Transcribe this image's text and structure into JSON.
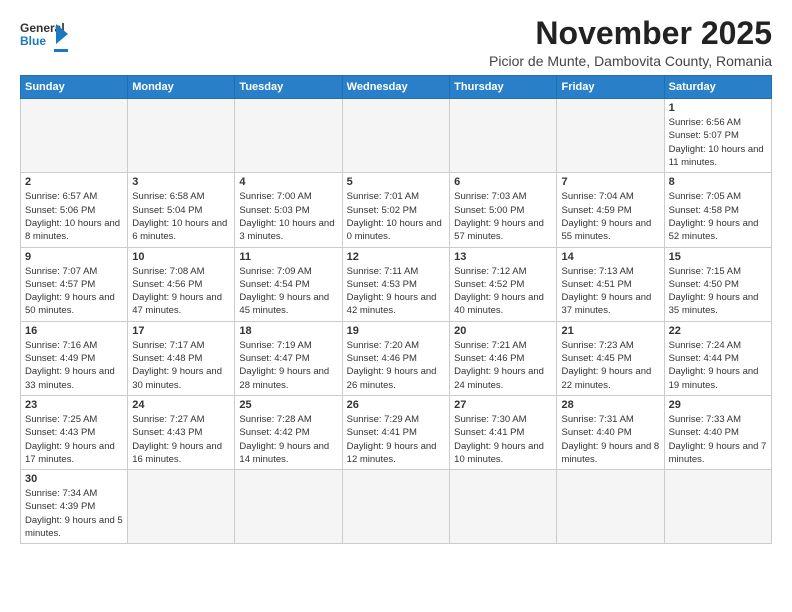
{
  "header": {
    "logo_general": "General",
    "logo_blue": "Blue",
    "month_title": "November 2025",
    "subtitle": "Picior de Munte, Dambovita County, Romania"
  },
  "weekdays": [
    "Sunday",
    "Monday",
    "Tuesday",
    "Wednesday",
    "Thursday",
    "Friday",
    "Saturday"
  ],
  "weeks": [
    [
      {
        "day": "",
        "empty": true
      },
      {
        "day": "",
        "empty": true
      },
      {
        "day": "",
        "empty": true
      },
      {
        "day": "",
        "empty": true
      },
      {
        "day": "",
        "empty": true
      },
      {
        "day": "",
        "empty": true
      },
      {
        "day": "1",
        "sunrise": "6:56 AM",
        "sunset": "5:07 PM",
        "daylight": "10 hours and 11 minutes."
      }
    ],
    [
      {
        "day": "2",
        "sunrise": "6:57 AM",
        "sunset": "5:06 PM",
        "daylight": "10 hours and 8 minutes."
      },
      {
        "day": "3",
        "sunrise": "6:58 AM",
        "sunset": "5:04 PM",
        "daylight": "10 hours and 6 minutes."
      },
      {
        "day": "4",
        "sunrise": "7:00 AM",
        "sunset": "5:03 PM",
        "daylight": "10 hours and 3 minutes."
      },
      {
        "day": "5",
        "sunrise": "7:01 AM",
        "sunset": "5:02 PM",
        "daylight": "10 hours and 0 minutes."
      },
      {
        "day": "6",
        "sunrise": "7:03 AM",
        "sunset": "5:00 PM",
        "daylight": "9 hours and 57 minutes."
      },
      {
        "day": "7",
        "sunrise": "7:04 AM",
        "sunset": "4:59 PM",
        "daylight": "9 hours and 55 minutes."
      },
      {
        "day": "8",
        "sunrise": "7:05 AM",
        "sunset": "4:58 PM",
        "daylight": "9 hours and 52 minutes."
      }
    ],
    [
      {
        "day": "9",
        "sunrise": "7:07 AM",
        "sunset": "4:57 PM",
        "daylight": "9 hours and 50 minutes."
      },
      {
        "day": "10",
        "sunrise": "7:08 AM",
        "sunset": "4:56 PM",
        "daylight": "9 hours and 47 minutes."
      },
      {
        "day": "11",
        "sunrise": "7:09 AM",
        "sunset": "4:54 PM",
        "daylight": "9 hours and 45 minutes."
      },
      {
        "day": "12",
        "sunrise": "7:11 AM",
        "sunset": "4:53 PM",
        "daylight": "9 hours and 42 minutes."
      },
      {
        "day": "13",
        "sunrise": "7:12 AM",
        "sunset": "4:52 PM",
        "daylight": "9 hours and 40 minutes."
      },
      {
        "day": "14",
        "sunrise": "7:13 AM",
        "sunset": "4:51 PM",
        "daylight": "9 hours and 37 minutes."
      },
      {
        "day": "15",
        "sunrise": "7:15 AM",
        "sunset": "4:50 PM",
        "daylight": "9 hours and 35 minutes."
      }
    ],
    [
      {
        "day": "16",
        "sunrise": "7:16 AM",
        "sunset": "4:49 PM",
        "daylight": "9 hours and 33 minutes."
      },
      {
        "day": "17",
        "sunrise": "7:17 AM",
        "sunset": "4:48 PM",
        "daylight": "9 hours and 30 minutes."
      },
      {
        "day": "18",
        "sunrise": "7:19 AM",
        "sunset": "4:47 PM",
        "daylight": "9 hours and 28 minutes."
      },
      {
        "day": "19",
        "sunrise": "7:20 AM",
        "sunset": "4:46 PM",
        "daylight": "9 hours and 26 minutes."
      },
      {
        "day": "20",
        "sunrise": "7:21 AM",
        "sunset": "4:46 PM",
        "daylight": "9 hours and 24 minutes."
      },
      {
        "day": "21",
        "sunrise": "7:23 AM",
        "sunset": "4:45 PM",
        "daylight": "9 hours and 22 minutes."
      },
      {
        "day": "22",
        "sunrise": "7:24 AM",
        "sunset": "4:44 PM",
        "daylight": "9 hours and 19 minutes."
      }
    ],
    [
      {
        "day": "23",
        "sunrise": "7:25 AM",
        "sunset": "4:43 PM",
        "daylight": "9 hours and 17 minutes."
      },
      {
        "day": "24",
        "sunrise": "7:27 AM",
        "sunset": "4:43 PM",
        "daylight": "9 hours and 16 minutes."
      },
      {
        "day": "25",
        "sunrise": "7:28 AM",
        "sunset": "4:42 PM",
        "daylight": "9 hours and 14 minutes."
      },
      {
        "day": "26",
        "sunrise": "7:29 AM",
        "sunset": "4:41 PM",
        "daylight": "9 hours and 12 minutes."
      },
      {
        "day": "27",
        "sunrise": "7:30 AM",
        "sunset": "4:41 PM",
        "daylight": "9 hours and 10 minutes."
      },
      {
        "day": "28",
        "sunrise": "7:31 AM",
        "sunset": "4:40 PM",
        "daylight": "9 hours and 8 minutes."
      },
      {
        "day": "29",
        "sunrise": "7:33 AM",
        "sunset": "4:40 PM",
        "daylight": "9 hours and 7 minutes."
      }
    ],
    [
      {
        "day": "30",
        "sunrise": "7:34 AM",
        "sunset": "4:39 PM",
        "daylight": "9 hours and 5 minutes."
      },
      {
        "day": "",
        "empty": true
      },
      {
        "day": "",
        "empty": true
      },
      {
        "day": "",
        "empty": true
      },
      {
        "day": "",
        "empty": true
      },
      {
        "day": "",
        "empty": true
      },
      {
        "day": "",
        "empty": true
      }
    ]
  ]
}
